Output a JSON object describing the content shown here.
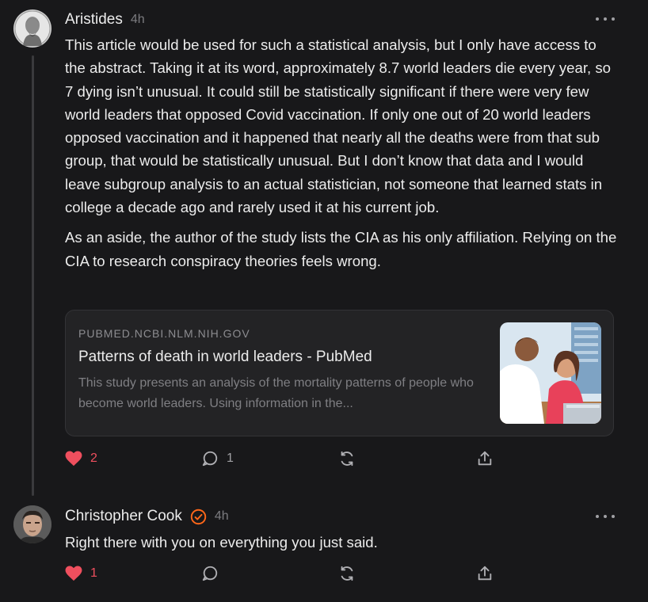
{
  "comments": [
    {
      "author": "Aristides",
      "time": "4h",
      "paragraphs": [
        "This article would be used for such a statistical analysis, but I only have access to the abstract. Taking it at its word, approximately 8.7 world leaders die every year, so 7 dying isn’t unusual. It could still be statistically significant if there were very few world leaders that opposed Covid vaccination. If only one out of 20 world leaders opposed vaccination and it happened that nearly all the deaths were from that sub group, that would be statistically unusual. But I don’t know that data and I would leave subgroup analysis to an actual statistician, not someone that learned stats in college a decade ago and rarely used it at his current job.",
        "As an aside, the author of the study lists the CIA as his only affiliation. Relying on the CIA to research conspiracy theories feels wrong."
      ],
      "link_card": {
        "domain": "PUBMED.NCBI.NLM.NIH.GOV",
        "title": "Patterns of death in world leaders - PubMed",
        "description": "This study presents an analysis of the mortality patterns of people who become world leaders. Using information in the..."
      },
      "likes": "2",
      "replies": "1"
    },
    {
      "author": "Christopher Cook",
      "time": "4h",
      "verified": true,
      "paragraphs": [
        "Right there with you on everything you just said."
      ],
      "likes": "1"
    }
  ],
  "colors": {
    "background": "#18181a",
    "like": "#ef4f5e",
    "verified": "#ff6719"
  }
}
